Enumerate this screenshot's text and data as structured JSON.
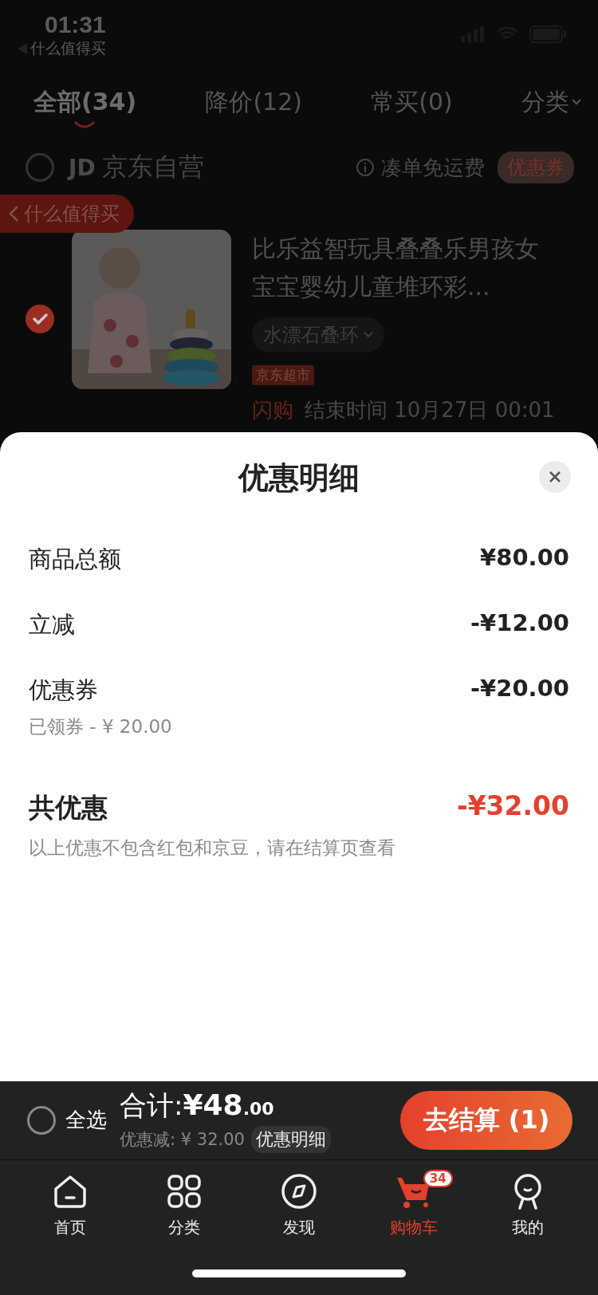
{
  "status_bar": {
    "time": "01:31",
    "back_app": "什么值得买"
  },
  "tabs": [
    {
      "label": "全部(34)",
      "selected": true
    },
    {
      "label": "降价(12)",
      "selected": false
    },
    {
      "label": "常买(0)",
      "selected": false
    }
  ],
  "category_filter": "分类",
  "store": {
    "checked": false,
    "logo": "JD",
    "name": "京东自营",
    "free_shipping": "凑单免运费",
    "coupon": "优惠券"
  },
  "floating_back": "什么值得买",
  "product": {
    "checked": true,
    "title": "比乐益智玩具叠叠乐男孩女宝宝婴幼儿童堆环彩...",
    "spec": "水漂石叠环",
    "tag": "京东超市",
    "flash_label": "闪购",
    "end_time": "结束时间 10月27日 00:01"
  },
  "sheet": {
    "title": "优惠明细",
    "rows": [
      {
        "label": "商品总额",
        "amount": "¥80.00"
      },
      {
        "label": "立减",
        "amount": "-¥12.00"
      },
      {
        "label": "优惠券",
        "amount": "-¥20.00",
        "note": "已领券 - ¥ 20.00"
      }
    ],
    "total": {
      "label": "共优惠",
      "amount": "-¥32.00"
    },
    "note": "以上优惠不包含红包和京豆，请在结算页查看"
  },
  "bottom_bar": {
    "select_all": {
      "label": "全选",
      "checked": false
    },
    "total_label": "合计:",
    "total_main": "¥48",
    "total_decimal": ".00",
    "discount": "优惠减: ¥ 32.00",
    "detail_link": "优惠明细",
    "checkout": "去结算 (1)"
  },
  "nav": [
    {
      "kind": "home",
      "label": "首页",
      "selected": false
    },
    {
      "kind": "grid",
      "label": "分类",
      "selected": false
    },
    {
      "kind": "compass",
      "label": "发现",
      "selected": false
    },
    {
      "kind": "cart",
      "label": "购物车",
      "selected": true,
      "badge": "34"
    },
    {
      "kind": "person",
      "label": "我的",
      "selected": false
    }
  ]
}
